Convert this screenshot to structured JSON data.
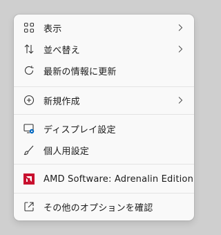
{
  "menu": {
    "items": [
      {
        "label": "表示",
        "icon": "grid-icon",
        "has_submenu": true
      },
      {
        "label": "並べ替え",
        "icon": "sort-icon",
        "has_submenu": true
      },
      {
        "label": "最新の情報に更新",
        "icon": "refresh-icon",
        "has_submenu": false
      },
      {
        "label": "新規作成",
        "icon": "add-circle-icon",
        "has_submenu": true
      },
      {
        "label": "ディスプレイ設定",
        "icon": "display-settings-icon",
        "has_submenu": false
      },
      {
        "label": "個人用設定",
        "icon": "brush-icon",
        "has_submenu": false
      },
      {
        "label": "AMD Software: Adrenalin Edition",
        "icon": "amd-logo-icon",
        "has_submenu": false
      },
      {
        "label": "その他のオプションを確認",
        "icon": "open-external-icon",
        "has_submenu": false
      }
    ]
  },
  "colors": {
    "accent": "#0067c0",
    "amd_red": "#c8102e"
  }
}
